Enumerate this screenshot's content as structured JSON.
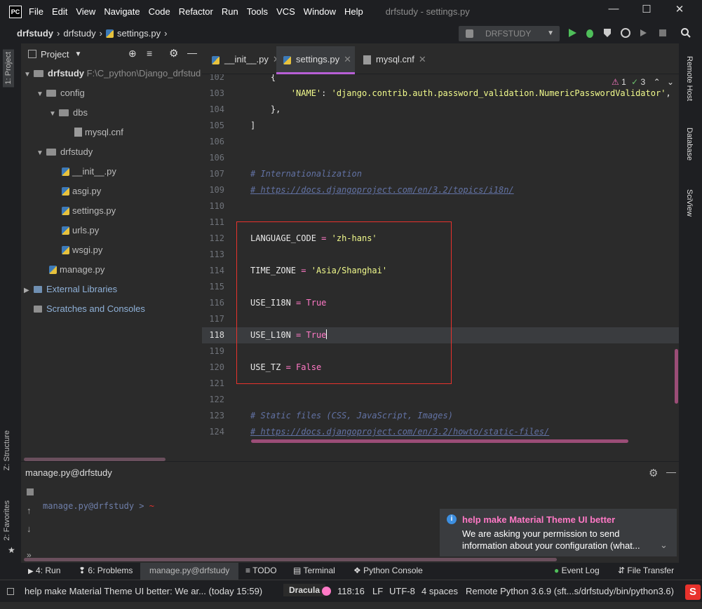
{
  "titlebar": {
    "logo": "PC",
    "menu": [
      "File",
      "Edit",
      "View",
      "Navigate",
      "Code",
      "Refactor",
      "Run",
      "Tools",
      "VCS",
      "Window",
      "Help"
    ],
    "window_title": "drfstudy - settings.py"
  },
  "navbar": {
    "crumbs": [
      "drfstudy",
      "drfstudy",
      "settings.py"
    ],
    "run_config": "DRFSTUDY"
  },
  "left_stripe": {
    "project_tab": "1: Project",
    "structure_tab": "Z: Structure",
    "favorites_tab": "2: Favorites"
  },
  "project": {
    "header": "Project",
    "tree": [
      {
        "label": "drfstudy",
        "path": "F:\\C_python\\Django_drfstud",
        "kind": "folder"
      },
      {
        "label": "config",
        "kind": "folder"
      },
      {
        "label": "dbs",
        "kind": "folder"
      },
      {
        "label": "mysql.cnf",
        "kind": "cnf"
      },
      {
        "label": "drfstudy",
        "kind": "folder"
      },
      {
        "label": "__init__.py",
        "kind": "py"
      },
      {
        "label": "asgi.py",
        "kind": "py"
      },
      {
        "label": "settings.py",
        "kind": "py"
      },
      {
        "label": "urls.py",
        "kind": "py"
      },
      {
        "label": "wsgi.py",
        "kind": "py"
      },
      {
        "label": "manage.py",
        "kind": "py"
      },
      {
        "label": "External Libraries",
        "kind": "lib"
      },
      {
        "label": "Scratches and Consoles",
        "kind": "scratch"
      }
    ]
  },
  "tabs": [
    {
      "label": "__init__.py"
    },
    {
      "label": "settings.py"
    },
    {
      "label": "mysql.cnf"
    }
  ],
  "inspection": {
    "warnings": "1",
    "weak": "3"
  },
  "right_stripe": {
    "remote_host": "Remote Host",
    "database": "Database",
    "sciview": "SciView"
  },
  "editor": {
    "lines": [
      {
        "n": "102",
        "code": "    {"
      },
      {
        "n": "103",
        "code": "        'NAME': 'django.contrib.auth.password_validation.NumericPasswordValidator',"
      },
      {
        "n": "104",
        "code": "    },"
      },
      {
        "n": "105",
        "code": "]"
      },
      {
        "n": "106",
        "code": ""
      },
      {
        "n": "107",
        "code": "# Internationalization"
      },
      {
        "n": "109",
        "code": "# https://docs.djangoproject.com/en/3.2/topics/i18n/"
      },
      {
        "n": "110",
        "code": ""
      },
      {
        "n": "111",
        "code": ""
      },
      {
        "n": "112",
        "code": "LANGUAGE_CODE = 'zh-hans'"
      },
      {
        "n": "113",
        "code": ""
      },
      {
        "n": "114",
        "code": "TIME_ZONE = 'Asia/Shanghai'"
      },
      {
        "n": "115",
        "code": ""
      },
      {
        "n": "116",
        "code": "USE_I18N = True"
      },
      {
        "n": "117",
        "code": ""
      },
      {
        "n": "118",
        "code": "USE_L10N = True"
      },
      {
        "n": "119",
        "code": ""
      },
      {
        "n": "120",
        "code": "USE_TZ = False"
      },
      {
        "n": "121",
        "code": ""
      },
      {
        "n": "122",
        "code": ""
      },
      {
        "n": "123",
        "code": "# Static files (CSS, JavaScript, Images)"
      },
      {
        "n": "124",
        "code": "# https://docs.djangoproject.com/en/3.2/howto/static-files/"
      }
    ]
  },
  "run_panel": {
    "title": "manage.py@drfstudy",
    "prompt": "manage.py@drfstudy >",
    "prompt_cursor": "~"
  },
  "notification": {
    "title": "help make Material Theme UI better",
    "body_line1": "We are asking your permission to send",
    "body_line2": "information about your configuration (what..."
  },
  "toolwindows": {
    "run": "4: Run",
    "problems": "6: Problems",
    "manage": "manage.py@drfstudy",
    "todo": "TODO",
    "terminal": "Terminal",
    "python_console": "Python Console",
    "event_log": "Event Log",
    "file_transfer": "File Transfer"
  },
  "status": {
    "message": "help make Material Theme UI better: We ar... (today 15:59)",
    "theme": "Dracula",
    "position": "118:16",
    "line_sep": "LF",
    "encoding": "UTF-8",
    "indent": "4 spaces",
    "interpreter": "Remote Python 3.6.9 (sft...s/drfstudy/bin/python3.6)"
  },
  "colors": {
    "accent": "#b85fd6",
    "highlight_box": "#e8322c",
    "notif_title": "#ff79c6"
  }
}
